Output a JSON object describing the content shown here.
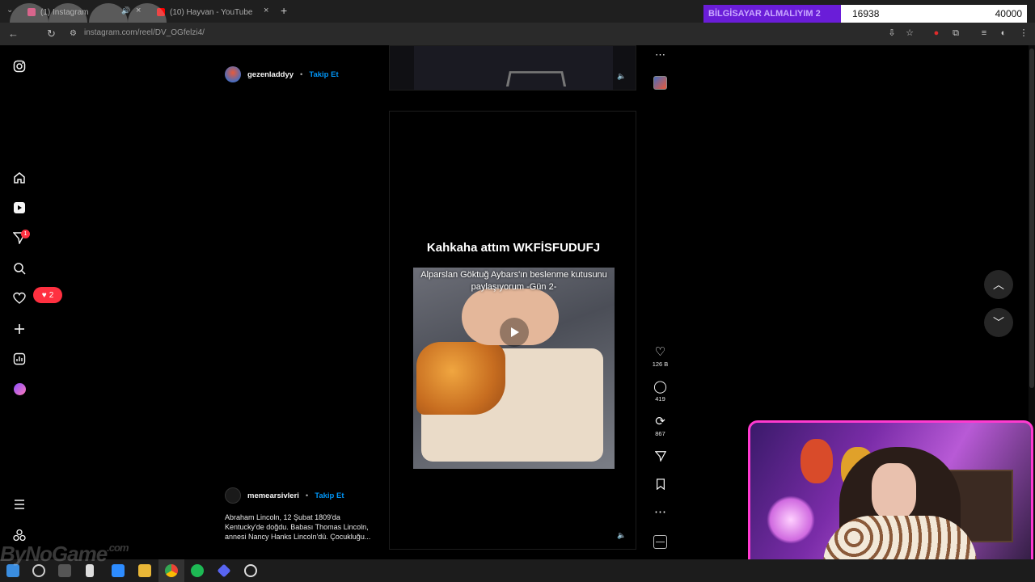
{
  "browser": {
    "tabs": [
      {
        "title": "(1) Instagram"
      },
      {
        "title": "(10) Hayvan - YouTube"
      }
    ],
    "url": "instagram.com/reel/DV_OGfelzi4/"
  },
  "donation_goal": {
    "label": "BİLGİSAYAR ALMALIYIM 2",
    "current": "16938",
    "target": "40000",
    "progress_fraction": 0.42,
    "colors": {
      "label_bg": "#6a1dd8",
      "bar_bg": "#ffffff"
    }
  },
  "sidebar": {
    "icons": [
      "instagram-icon",
      "home-icon",
      "reels-icon",
      "messages-icon",
      "search-icon",
      "heart-icon",
      "create-icon",
      "dashboard-icon",
      "profile-icon",
      "menu-icon",
      "threads-icon"
    ],
    "messages_badge": "1",
    "notifications_count": "2"
  },
  "posts": [
    {
      "author": "gezenladdyy",
      "separator": "•",
      "follow_label": "Takip Et"
    },
    {
      "author": "memearsivleri",
      "separator": "•",
      "follow_label": "Takip Et",
      "caption": "Abraham Lincoln, 12 Şubat 1809'da Kentucky'de doğdu. Babası Thomas Lincoln, annesi Nancy Hanks Lincoln'dü. Çocukluğu..."
    }
  ],
  "reel": {
    "title": "Kahkaha attım WKFİSFUDUFJ",
    "video_overlay": "Alparslan Göktuğ Aybars'ın beslenme kutusunu paylaşıyorum -Gün 2-"
  },
  "actions": {
    "likes": "126 B",
    "comments": "419",
    "reposts": "867"
  },
  "taskbar": {
    "watermark": "ByNoGame",
    "watermark_suffix": ".com"
  },
  "colors": {
    "accent_blue": "#0095f6",
    "notification_red": "#ff3040",
    "webcam_border": "#ff3ad0"
  }
}
